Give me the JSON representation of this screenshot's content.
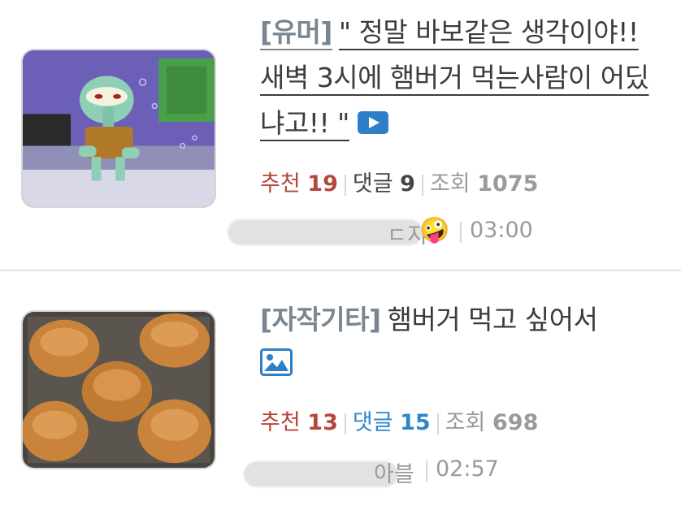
{
  "posts": [
    {
      "category": "[유머]",
      "title": "\" 정말 바보같은 생각이야!! 새벽 3시에 햄버거 먹는사람이 어딨냐고!! \"",
      "media_icon": "video-icon",
      "stats": {
        "recommend_label": "추천",
        "recommend_count": "19",
        "comment_label": "댓글",
        "comment_count": "9",
        "views_label": "조회",
        "views_count": "1075"
      },
      "author_tail": "ㄷ지",
      "author_emoji": "🤪",
      "time": "03:00",
      "thumbnail": "squidward-cartoon-thumbnail"
    },
    {
      "category": "[자작기타]",
      "title": "햄버거 먹고 싶어서",
      "media_icon": "image-icon",
      "stats": {
        "recommend_label": "추천",
        "recommend_count": "13",
        "comment_label": "댓글",
        "comment_count": "15",
        "views_label": "조회",
        "views_count": "698"
      },
      "author_tail": "아블",
      "time": "02:57",
      "thumbnail": "burger-buns-thumbnail"
    }
  ],
  "colors": {
    "recommend": "#b5463a",
    "comment_highlight": "#2c86c9",
    "muted": "#9a9a9a",
    "category": "#7a8590",
    "media_icon": "#2f7fc8"
  }
}
